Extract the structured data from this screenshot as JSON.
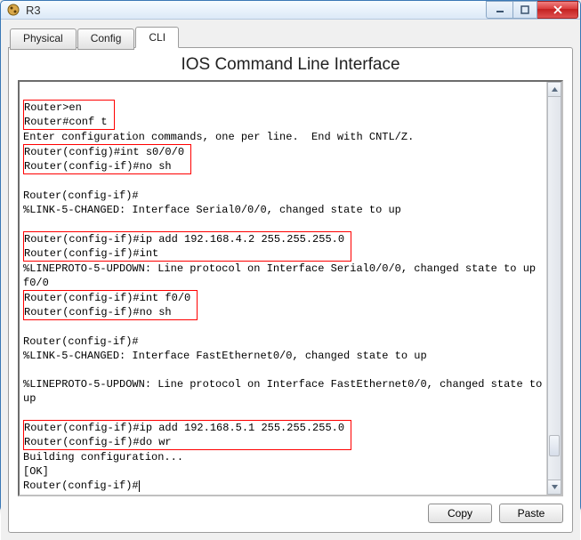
{
  "window": {
    "title": "R3"
  },
  "tabs": {
    "items": [
      {
        "label": "Physical",
        "active": false
      },
      {
        "label": "Config",
        "active": false
      },
      {
        "label": "CLI",
        "active": true
      }
    ]
  },
  "panel": {
    "title": "IOS Command Line Interface"
  },
  "terminal": {
    "lines": [
      "",
      "Router>en",
      "Router#conf t",
      "Enter configuration commands, one per line.  End with CNTL/Z.",
      "Router(config)#int s0/0/0",
      "Router(config-if)#no sh",
      "",
      "Router(config-if)#",
      "%LINK-5-CHANGED: Interface Serial0/0/0, changed state to up",
      "",
      "Router(config-if)#ip add 192.168.4.2 255.255.255.0",
      "Router(config-if)#int",
      "%LINEPROTO-5-UPDOWN: Line protocol on Interface Serial0/0/0, changed state to up",
      "f0/0",
      "Router(config-if)#int f0/0",
      "Router(config-if)#no sh",
      "",
      "Router(config-if)#",
      "%LINK-5-CHANGED: Interface FastEthernet0/0, changed state to up",
      "",
      "%LINEPROTO-5-UPDOWN: Line protocol on Interface FastEthernet0/0, changed state to",
      "up",
      "",
      "Router(config-if)#ip add 192.168.5.1 255.255.255.0",
      "Router(config-if)#do wr",
      "Building configuration...",
      "[OK]",
      "Router(config-if)#"
    ],
    "highlight_groups": [
      {
        "start": 1,
        "end": 2
      },
      {
        "start": 4,
        "end": 5
      },
      {
        "start": 10,
        "end": 11
      },
      {
        "start": 14,
        "end": 15
      },
      {
        "start": 23,
        "end": 24
      }
    ]
  },
  "buttons": {
    "copy": "Copy",
    "paste": "Paste"
  },
  "scrollbar": {
    "thumb_position_pct": 94
  },
  "colors": {
    "highlight_border": "#ff0000",
    "window_border": "#3a78b5",
    "close_red": "#d93b3b"
  }
}
